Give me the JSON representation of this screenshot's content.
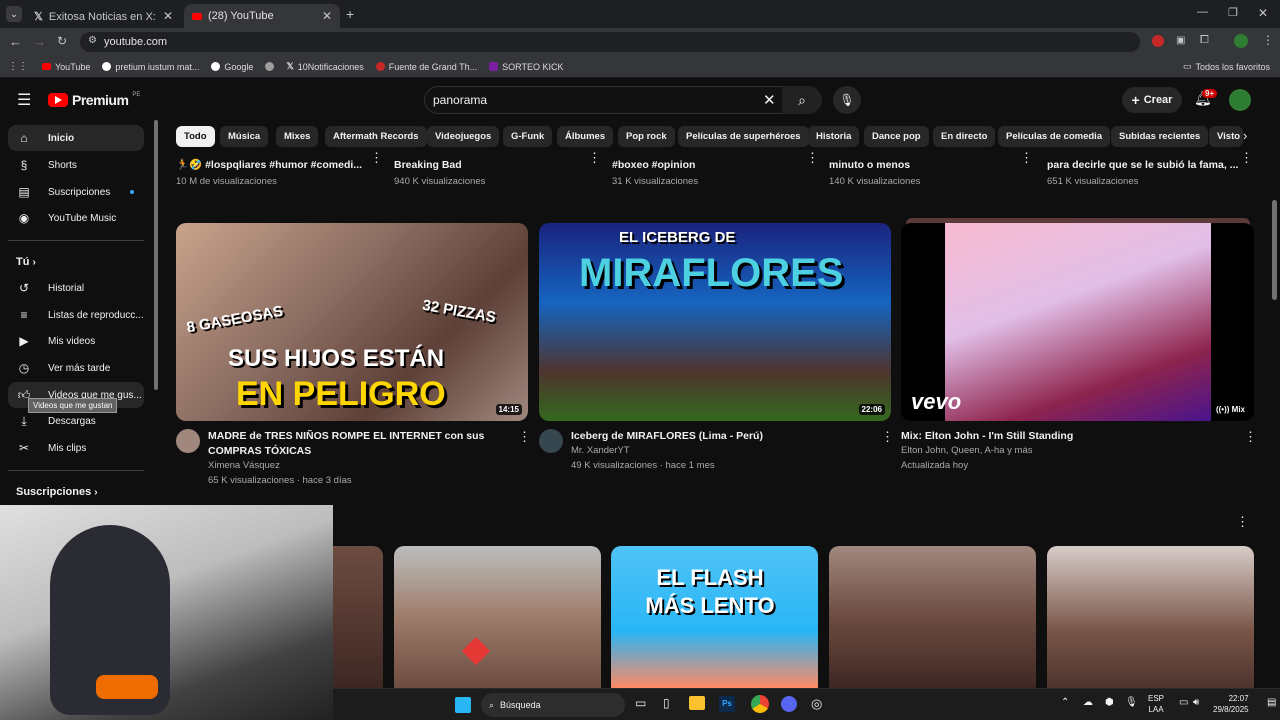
{
  "browser": {
    "tabs": [
      {
        "label": "Exitosa Noticias en X: \"🔴🔵 A"
      },
      {
        "label": "(28) YouTube"
      }
    ],
    "url": "youtube.com",
    "bookmarks": [
      "YouTube",
      "pretium iustum mat...",
      "Google",
      "10Notificaciones",
      "Fuente de Grand Th...",
      "SORTEO KICK"
    ],
    "all_favorites": "Todos los favoritos"
  },
  "yt": {
    "logo": "Premium",
    "country": "PE",
    "search_value": "panorama",
    "create_label": "Crear",
    "notif_badge": "9+"
  },
  "sidebar": {
    "items": [
      {
        "label": "Inicio",
        "icon": "home-icon"
      },
      {
        "label": "Shorts",
        "icon": "shorts-icon"
      },
      {
        "label": "Suscripciones",
        "icon": "subscriptions-icon"
      },
      {
        "label": "YouTube Music",
        "icon": "music-icon"
      }
    ],
    "you_label": "Tú",
    "you_items": [
      {
        "label": "Historial",
        "icon": "history-icon"
      },
      {
        "label": "Listas de reproducc...",
        "icon": "playlists-icon"
      },
      {
        "label": "Mis videos",
        "icon": "video-icon"
      },
      {
        "label": "Ver más tarde",
        "icon": "clock-icon"
      },
      {
        "label": "Videos que me gus...",
        "icon": "like-icon"
      },
      {
        "label": "Descargas",
        "icon": "download-icon"
      },
      {
        "label": "Mis clips",
        "icon": "scissors-icon"
      }
    ],
    "tooltip": "Videos que me gustan",
    "subs_label": "Suscripciones"
  },
  "chips": [
    "Todo",
    "Música",
    "Mixes",
    "Aftermath Records",
    "Videojuegos",
    "G-Funk",
    "Álbumes",
    "Pop rock",
    "Películas de superhéroes",
    "Historia",
    "Dance pop",
    "En directo",
    "Películas de comedia",
    "Subidas recientes",
    "Visto"
  ],
  "top_row": [
    {
      "title": "🏃🤣 #lospqliares #humor #comedi...",
      "meta": "10 M de visualizaciones"
    },
    {
      "title": "Breaking Bad",
      "meta": "940 K visualizaciones"
    },
    {
      "title": "#boxeo #opinion",
      "meta": "31 K visualizaciones"
    },
    {
      "title": "minuto o menos",
      "meta": "140 K visualizaciones"
    },
    {
      "title": "para decirle que se le subió la fama, ...",
      "meta": "651 K visualizaciones"
    }
  ],
  "videos": [
    {
      "thumb_text1": "8 GASEOSAS",
      "thumb_text2": "32 PIZZAS",
      "thumb_text3": "SUS HIJOS ESTÁN",
      "thumb_text4": "EN PELIGRO",
      "duration": "14:15",
      "title": "MADRE de TRES NIÑOS ROMPE EL INTERNET con sus COMPRAS TÓXICAS",
      "channel": "Ximena Vásquez",
      "stats": "65 K visualizaciones · hace 3 días"
    },
    {
      "thumb_text1": "EL ICEBERG DE",
      "thumb_text2": "MIRAFLORES",
      "duration": "22:06",
      "title": "Iceberg de MIRAFLORES (Lima - Perú)",
      "channel": "Mr. XanderYT",
      "stats": "49 K visualizaciones · hace 1 mes"
    },
    {
      "thumb_text1": "vevo",
      "duration": "Mix",
      "title": "Mix: Elton John - I'm Still Standing",
      "channel": "Elton John, Queen, A-ha y más",
      "stats": "Actualizada hoy"
    }
  ],
  "shorts": [
    {
      "text": ""
    },
    {
      "text": ""
    },
    {
      "text": "EL FLASH MÁS LENTO"
    },
    {
      "text": ""
    },
    {
      "text": ""
    }
  ],
  "taskbar": {
    "search": "Búsqueda",
    "lang1": "ESP",
    "lang2": "LAA",
    "time": "22:07",
    "date": "29/8/2025"
  },
  "colors": {
    "accent": "#ff0000",
    "bg": "#0f0f0f",
    "chip": "#272727"
  }
}
